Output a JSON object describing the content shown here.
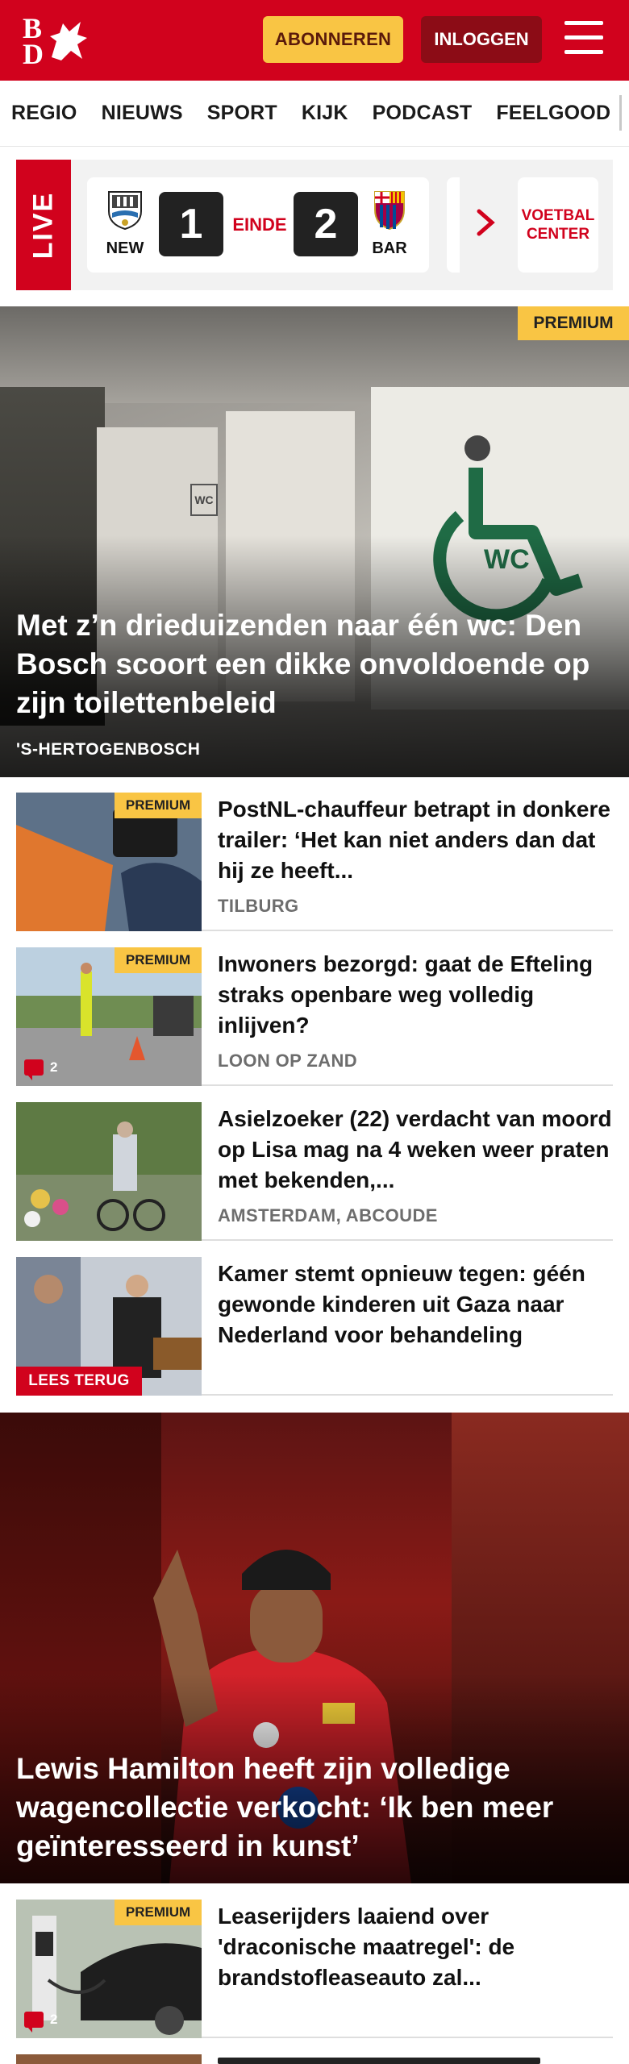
{
  "header": {
    "logo_top": "B",
    "logo_bottom": "D",
    "subscribe_label": "ABONNEREN",
    "login_label": "INLOGGEN"
  },
  "nav": {
    "items": [
      "REGIO",
      "NIEUWS",
      "SPORT",
      "KIJK",
      "PODCAST",
      "FEELGOOD"
    ]
  },
  "live": {
    "badge": "LIVE",
    "home_team": "NEW",
    "away_team": "BAR",
    "home_score": "1",
    "away_score": "2",
    "status": "EINDE",
    "voetbal_center": "VOETBAL CENTER"
  },
  "hero": {
    "premium": "PREMIUM",
    "sign_text": "WC",
    "title": "Met z’n drieduizenden naar één wc: Den Bosch scoort een dikke onvoldoende op zijn toilettenbeleid",
    "location": "'S-HERTOGENBOSCH"
  },
  "articles": [
    {
      "title": "PostNL-chauffeur betrapt in donkere trailer: ‘Het kan niet anders dan dat hij ze heeft...",
      "location": "TILBURG",
      "premium": "PREMIUM",
      "comments": ""
    },
    {
      "title": "Inwoners bezorgd: gaat de Efteling straks openbare weg volledig inlijven?",
      "location": "LOON OP ZAND",
      "premium": "PREMIUM",
      "comments": "2"
    },
    {
      "title": "Asielzoeker (22) verdacht van moord op Lisa mag na 4 weken weer praten met bekenden,...",
      "location": "AMSTERDAM, ABCOUDE",
      "premium": "",
      "comments": ""
    },
    {
      "title": "Kamer stemt opnieuw tegen: géén gewonde kinderen uit Gaza naar Nederland voor behandeling",
      "location": "",
      "premium": "",
      "badge": "LEES TERUG"
    }
  ],
  "hero2": {
    "title": "Lewis Hamilton heeft zijn volledige wagencollectie verkocht: ‘Ik ben meer geïnteresseerd in kunst’"
  },
  "article5": {
    "title": "Leaserijders laaiend over 'draconische maatregel': de brandstofleaseauto zal...",
    "premium": "PREMIUM",
    "comments": "2"
  },
  "colors": {
    "brand_red": "#d1021d",
    "premium_yellow": "#f9c544",
    "login_dark_red": "#8c0c16"
  }
}
